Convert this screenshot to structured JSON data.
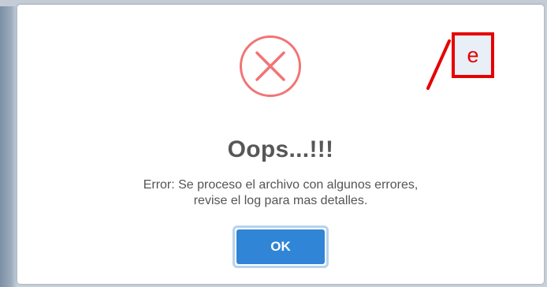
{
  "dialog": {
    "title": "Oops...!!!",
    "message_line1": "Error: Se proceso el archivo con algunos errores,",
    "message_line2": "revise el log para mas detalles.",
    "ok_label": "OK",
    "icon": "error-x-icon"
  },
  "annotation": {
    "label": "e"
  },
  "colors": {
    "error_icon": "#f27474",
    "ok_button": "#3085d6",
    "ok_focus_ring": "#b7d3ec",
    "title_text": "#575757",
    "annotation": "#e60000"
  }
}
